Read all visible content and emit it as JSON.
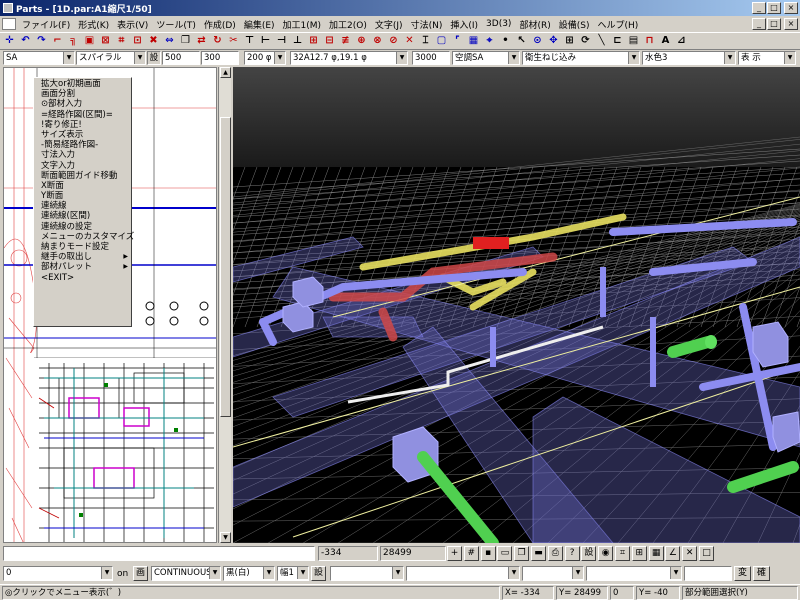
{
  "window": {
    "title": "Parts - [1D.par:A1縮尺1/50]",
    "buttons": [
      "_",
      "□",
      "×"
    ]
  },
  "menu": {
    "items": [
      "ファイル(F)",
      "形式(K)",
      "表示(V)",
      "ツール(T)",
      "作成(D)",
      "編集(E)",
      "加工1(M)",
      "加工2(O)",
      "文字(J)",
      "寸法(N)",
      "挿入(I)",
      "3D(3)",
      "部材(R)",
      "設備(S)",
      "ヘルプ(H)"
    ],
    "doc_buttons": [
      "_",
      "□",
      "×"
    ]
  },
  "toolbar": {
    "icons": [
      {
        "name": "move-icon",
        "glyph": "✛",
        "color": "#0000c0"
      },
      {
        "name": "undo-icon",
        "glyph": "↶",
        "color": "#0000c0"
      },
      {
        "name": "redo-icon",
        "glyph": "↷",
        "color": "#0000c0"
      },
      {
        "name": "corner-icon",
        "glyph": "⌐",
        "color": "#c00000"
      },
      {
        "name": "fillet-icon",
        "glyph": "╗",
        "color": "#c00000"
      },
      {
        "name": "frame-icon",
        "glyph": "▣",
        "color": "#c00000"
      },
      {
        "name": "box-icon",
        "glyph": "⊠",
        "color": "#c00000"
      },
      {
        "name": "grid-icon",
        "glyph": "⌗",
        "color": "#c00000"
      },
      {
        "name": "select-icon",
        "glyph": "⊡",
        "color": "#c00000"
      },
      {
        "name": "erase-icon",
        "glyph": "✖",
        "color": "#c00000"
      },
      {
        "name": "arrows-icon",
        "glyph": "⇔",
        "color": "#0000c0"
      },
      {
        "name": "copy-icon",
        "glyph": "❐",
        "color": "#000000"
      },
      {
        "name": "mirror-icon",
        "glyph": "⇄",
        "color": "#c00000"
      },
      {
        "name": "rotate-icon",
        "glyph": "↻",
        "color": "#c00000"
      },
      {
        "name": "cut-icon",
        "glyph": "✂",
        "color": "#c00000"
      },
      {
        "name": "line-t-icon",
        "glyph": "⊤",
        "color": "#000000"
      },
      {
        "name": "line-join-icon",
        "glyph": "⊢",
        "color": "#000000"
      },
      {
        "name": "trim-icon",
        "glyph": "⊣",
        "color": "#000000"
      },
      {
        "name": "extend-icon",
        "glyph": "⊥",
        "color": "#000000"
      },
      {
        "name": "offset-icon",
        "glyph": "⊞",
        "color": "#c00000"
      },
      {
        "name": "array-icon",
        "glyph": "⊟",
        "color": "#c00000"
      },
      {
        "name": "break-icon",
        "glyph": "≢",
        "color": "#c00000"
      },
      {
        "name": "scale-icon",
        "glyph": "⊕",
        "color": "#c00000"
      },
      {
        "name": "stretch-icon",
        "glyph": "⊗",
        "color": "#c00000"
      },
      {
        "name": "chamfer-icon",
        "glyph": "⊘",
        "color": "#c00000"
      },
      {
        "name": "cross-icon",
        "glyph": "✕",
        "color": "#c00000"
      },
      {
        "name": "bracket-icon",
        "glyph": "⌶",
        "color": "#000000"
      },
      {
        "name": "window-icon",
        "glyph": "▢",
        "color": "#0000c0"
      },
      {
        "name": "corner2-icon",
        "glyph": "⌜",
        "color": "#0000c0"
      },
      {
        "name": "hatch-icon",
        "glyph": "▦",
        "color": "#0000c0"
      },
      {
        "name": "measure-icon",
        "glyph": "⌖",
        "color": "#0000c0"
      },
      {
        "name": "point-icon",
        "glyph": "•",
        "color": "#000000"
      },
      {
        "name": "cursor-icon",
        "glyph": "↖",
        "color": "#000000"
      },
      {
        "name": "zoom-icon",
        "glyph": "⊙",
        "color": "#0000c0"
      },
      {
        "name": "pan-icon",
        "glyph": "✥",
        "color": "#0000c0"
      },
      {
        "name": "zoomall-icon",
        "glyph": "⊞",
        "color": "#000000"
      },
      {
        "name": "redraw-icon",
        "glyph": "⟳",
        "color": "#000000"
      },
      {
        "name": "diagonal-icon",
        "glyph": "╲",
        "color": "#000000"
      },
      {
        "name": "connect-icon",
        "glyph": "⊏",
        "color": "#000000"
      },
      {
        "name": "layer-icon",
        "glyph": "▤",
        "color": "#000000"
      },
      {
        "name": "pipe-icon",
        "glyph": "⊓",
        "color": "#c00000"
      },
      {
        "name": "text-icon",
        "glyph": "A",
        "color": "#000000"
      },
      {
        "name": "dimension-icon",
        "glyph": "⊿",
        "color": "#000000"
      }
    ]
  },
  "properties": {
    "field1": "SA",
    "field2": "スパイラル",
    "field3": "500",
    "field4": "300",
    "field5": "200 φ",
    "field6": "32A12.7 φ,19.1 φ",
    "field7": "3000",
    "field8": "空調SA",
    "field9": "衛生ねじ込み",
    "field10": "水色3",
    "field11": "表 示"
  },
  "context_menu": {
    "items": [
      {
        "label": "拡大or初期画面",
        "submenu": false
      },
      {
        "label": "画面分割",
        "submenu": false
      },
      {
        "label": "⊙部材入力",
        "submenu": false
      },
      {
        "label": "=経路作図(区間)=",
        "submenu": false
      },
      {
        "label": "!寄り修正!",
        "submenu": false
      },
      {
        "label": "サイズ表示",
        "submenu": false
      },
      {
        "label": "-簡易経路作図-",
        "submenu": false
      },
      {
        "label": "寸法入力",
        "submenu": false
      },
      {
        "label": "文字入力",
        "submenu": false
      },
      {
        "label": "断面範囲ガイド移動",
        "submenu": false
      },
      {
        "label": "X断面",
        "submenu": false
      },
      {
        "label": "Y断面",
        "submenu": false
      },
      {
        "label": "連続線",
        "submenu": false
      },
      {
        "label": "連続線(区間)",
        "submenu": false
      },
      {
        "label": "連続線の設定",
        "submenu": false
      },
      {
        "label": "メニューのカスタマイズ",
        "submenu": false
      },
      {
        "label": "納まりモード設定",
        "submenu": false
      },
      {
        "label": "継手の取出し",
        "submenu": true
      },
      {
        "label": "部材パレット",
        "submenu": true
      },
      {
        "label": "<EXIT>",
        "submenu": false
      }
    ]
  },
  "coords_row": {
    "x": "-334",
    "y": "28499",
    "setting_label": "設"
  },
  "layer_row": {
    "layer": "0",
    "on_label": "on",
    "btn1": "画",
    "linetype": "CONTINUOUS",
    "color": "黒(白)",
    "width": "幅1",
    "setting": "設",
    "change_btn": "変",
    "confirm_btn": "確"
  },
  "status": {
    "message": "◎クリックでメニュー表示(゛)",
    "x_label": "X=",
    "x_value": "-334",
    "y_label": "Y=",
    "y_value": "28499",
    "z_label": "0",
    "z2_label": "Y=",
    "z_value": "-40",
    "mode": "部分範囲選択(Y)"
  },
  "colors": {
    "titlebar": "#0a246a",
    "chrome": "#d4d0c8",
    "pipe_yellow": "#e8e070",
    "pipe_red": "#d05050",
    "pipe_blue": "#8080e0",
    "pipe_green": "#50d050",
    "viewport": "#000000"
  }
}
